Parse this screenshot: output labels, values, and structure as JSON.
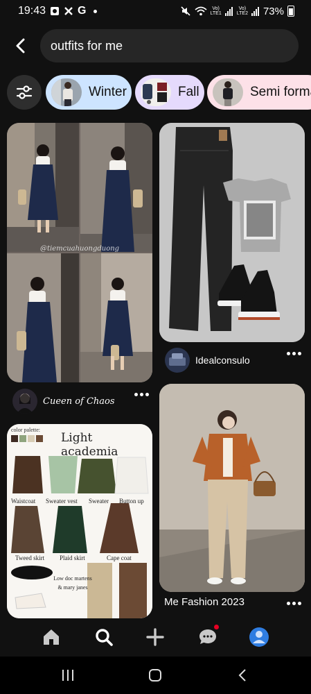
{
  "status_bar": {
    "time": "19:43",
    "carrier_g": "G",
    "lte1": "LTE1",
    "lte2": "LTE2",
    "volte_label": "Vo)",
    "battery": "73%"
  },
  "search": {
    "query": "outfits for me"
  },
  "chips": [
    {
      "label": "Winter",
      "color": "#cde4ff"
    },
    {
      "label": "Fall",
      "color": "#e5dafc"
    },
    {
      "label": "Semi forma",
      "color": "#fde1e8"
    }
  ],
  "pins": {
    "pin_1": {
      "watermark": "@tiemcuahuongduong"
    },
    "pin_2": {
      "author": "Idealconsulo"
    },
    "pin_1_author": "Cueen of Chaos",
    "pin_3": {
      "title": "Me Fashion 2023"
    },
    "pin_4": {
      "title": "Light academia",
      "palette_label": "color palette:",
      "labels": {
        "waistcoat": "Waistcoat",
        "sweater_vest": "Sweater vest",
        "sweater": "Sweater",
        "button_up": "Button up",
        "tweed_skirt": "Tweed skirt",
        "plaid_skirt": "Plaid skirt",
        "cape_coat": "Cape coat",
        "note": "Low doc martens & mary janes"
      }
    }
  },
  "bottom_nav": [
    "home-icon",
    "search-icon",
    "create-icon",
    "messages-icon",
    "profile-icon"
  ],
  "colors": {
    "background": "#111111",
    "search_bg": "#262626",
    "notification": "#e60023",
    "profile": "#2f7de1"
  }
}
